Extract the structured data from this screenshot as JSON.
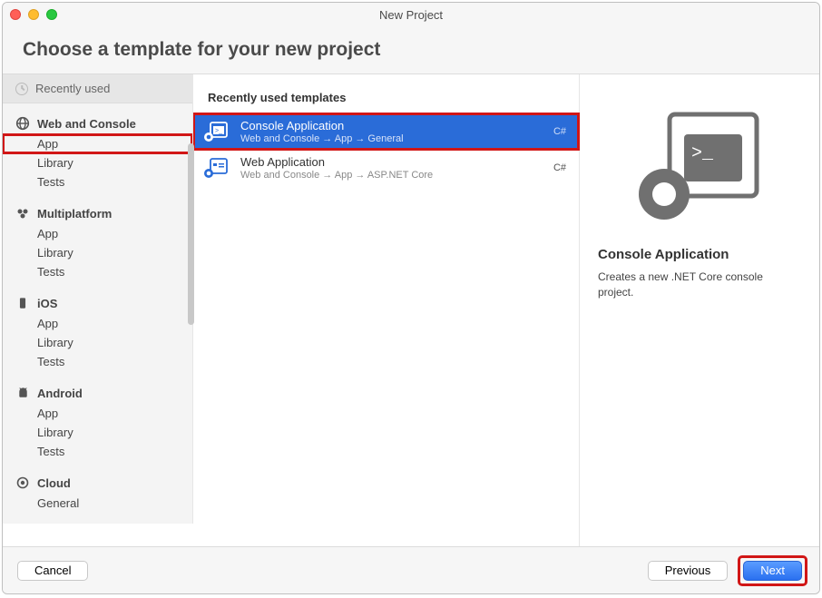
{
  "window": {
    "title": "New Project"
  },
  "header": {
    "title": "Choose a template for your new project"
  },
  "sidebar": {
    "recent_label": "Recently used",
    "categories": [
      {
        "name": "Web and Console",
        "items": [
          "App",
          "Library",
          "Tests"
        ]
      },
      {
        "name": "Multiplatform",
        "items": [
          "App",
          "Library",
          "Tests"
        ]
      },
      {
        "name": "iOS",
        "items": [
          "App",
          "Library",
          "Tests"
        ]
      },
      {
        "name": "Android",
        "items": [
          "App",
          "Library",
          "Tests"
        ]
      },
      {
        "name": "Cloud",
        "items": [
          "General"
        ]
      }
    ]
  },
  "center": {
    "heading": "Recently used templates",
    "templates": [
      {
        "name": "Console Application",
        "path": "Web and Console → App → General",
        "lang": "C#"
      },
      {
        "name": "Web Application",
        "path": "Web and Console → App → ASP.NET Core",
        "lang": "C#"
      }
    ]
  },
  "preview": {
    "title": "Console Application",
    "description": "Creates a new .NET Core console project."
  },
  "footer": {
    "cancel": "Cancel",
    "previous": "Previous",
    "next": "Next"
  }
}
